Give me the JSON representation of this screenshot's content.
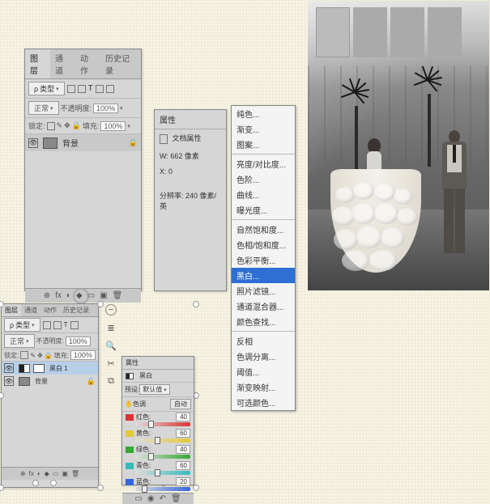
{
  "layers_panel": {
    "tabs": [
      "图层",
      "通道",
      "动作",
      "历史记录"
    ],
    "type_label": "类型",
    "blend_mode": "正常",
    "opacity_label": "不透明度:",
    "opacity_value": "100%",
    "lock_label": "锁定:",
    "fill_label": "填充:",
    "fill_value": "100%",
    "layers": [
      {
        "name": "背景",
        "locked": true
      }
    ],
    "footer_icons": [
      "⊕",
      "fx",
      "◐",
      "◆",
      "▭",
      "▣",
      "🗑"
    ]
  },
  "props_panel": {
    "title": "属性",
    "subtitle": "文档属性",
    "width_label": "W:",
    "width_value": "662 像素",
    "x_label": "X:",
    "x_value": "0",
    "res_label": "分辨率:",
    "res_value": "240 像素/英"
  },
  "context_menu": {
    "groups": [
      [
        "纯色...",
        "渐变...",
        "图案..."
      ],
      [
        "亮度/对比度...",
        "色阶...",
        "曲线...",
        "曝光度..."
      ],
      [
        "自然饱和度...",
        "色相/饱和度...",
        "色彩平衡...",
        "黑白...",
        "照片滤镜...",
        "通道混合器...",
        "颜色查找..."
      ],
      [
        "反相",
        "色调分离...",
        "阈值...",
        "渐变映射...",
        "可选颜色..."
      ]
    ],
    "selected": "黑白..."
  },
  "layers_panel2": {
    "tabs": [
      "图层",
      "通道",
      "动作",
      "历史记录"
    ],
    "type_label": "类型",
    "blend_mode": "正常",
    "opacity_label": "不透明度:",
    "opacity_value": "100%",
    "lock_label": "锁定:",
    "fill_label": "填充:",
    "fill_value": "100%",
    "layers": [
      {
        "name": "黑白 1",
        "locked": false
      },
      {
        "name": "背景",
        "locked": true
      }
    ],
    "footer_icons": [
      "⊕",
      "fx",
      "◐",
      "◆",
      "▭",
      "▣",
      "🗑"
    ]
  },
  "bw_props": {
    "title": "属性",
    "subtitle": "黑白",
    "preset_label": "预设:",
    "preset_value": "默认值",
    "auto_label": "自动",
    "tint_label": "色调",
    "sliders": [
      {
        "label": "红色:",
        "value": 40,
        "color": "#d33"
      },
      {
        "label": "黄色:",
        "value": 60,
        "color": "#e5c935"
      },
      {
        "label": "绿色:",
        "value": 40,
        "color": "#3a3"
      },
      {
        "label": "青色:",
        "value": 60,
        "color": "#3bb"
      },
      {
        "label": "蓝色:",
        "value": 20,
        "color": "#36d"
      }
    ],
    "footer_icons": [
      "▭",
      "◉",
      "↶",
      "🗑"
    ]
  },
  "strip_icons": [
    "−",
    "≣",
    "🔍",
    "✂",
    "⧉"
  ]
}
